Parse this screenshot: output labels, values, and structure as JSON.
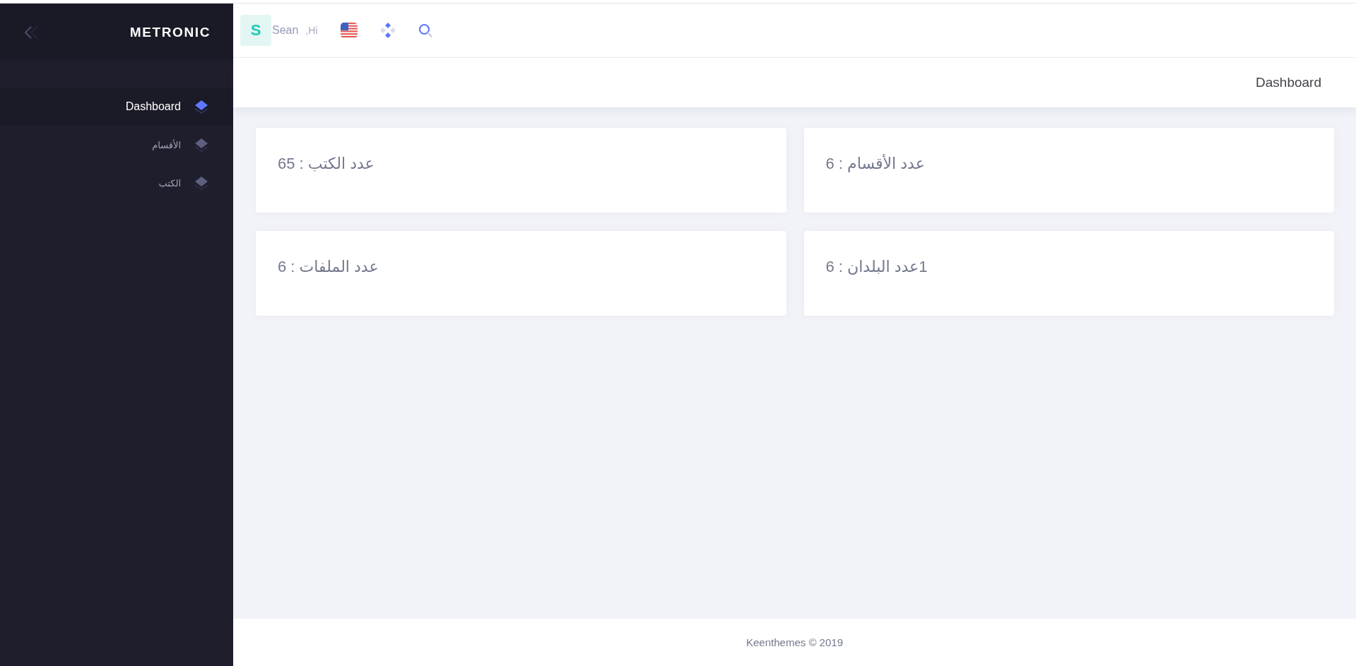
{
  "sidebar": {
    "brand": "METRONIC",
    "items": [
      {
        "label": "Dashboard",
        "selected": true
      },
      {
        "label": "الأقسام",
        "selected": false
      },
      {
        "label": "الكتب",
        "selected": false
      }
    ]
  },
  "topbar": {
    "user": {
      "initial": "S",
      "name": "Sean",
      "greeting": ",Hi"
    }
  },
  "subheader": {
    "title": "Dashboard"
  },
  "cards": [
    {
      "text": "عدد الأقسام : 6"
    },
    {
      "text": "عدد الكتب : 65"
    },
    {
      "text": "1عدد البلدان : 6"
    },
    {
      "text": "عدد الملفات : 6"
    }
  ],
  "footer": {
    "text": "Keenthemes © 2019"
  }
}
